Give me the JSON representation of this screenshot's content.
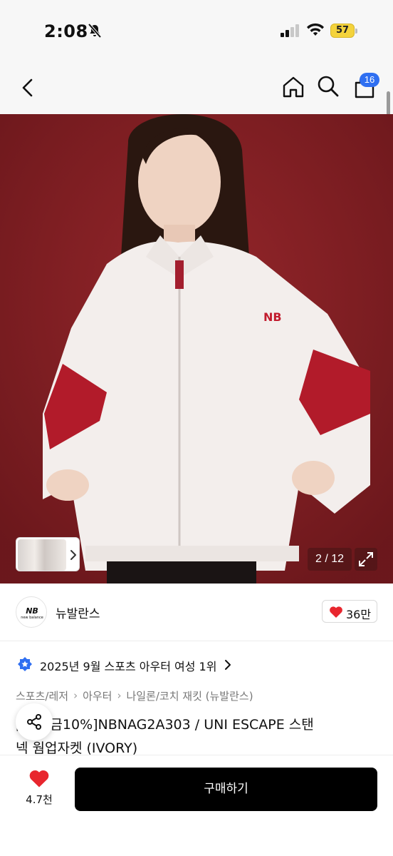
{
  "status_bar": {
    "time": "2:08",
    "battery": "57"
  },
  "nav": {
    "cart_count": "16"
  },
  "gallery": {
    "counter": "2 / 12",
    "background_color": "#8a1f24"
  },
  "brand": {
    "name": "뉴발란스",
    "logo_text": "new balance",
    "likes": "36만"
  },
  "ranking": {
    "text": "2025년 9월 스포츠 아우터 여성 1위"
  },
  "breadcrumb": [
    "스포츠/레저",
    "아우터",
    "나일론/코치 재킷 (뉴발란스)"
  ],
  "product": {
    "title_line1": "[최대 금10%]NBNAG2A303 / UNI ESCAPE 스탠",
    "title_line2": "넥 웜업자켓 (IVORY)"
  },
  "bottom": {
    "wish_count": "4.7천",
    "buy_label": "구매하기"
  },
  "colors": {
    "accent_blue": "#2f6ff1",
    "heart_red": "#e8262e",
    "buy_button": "#000000"
  }
}
